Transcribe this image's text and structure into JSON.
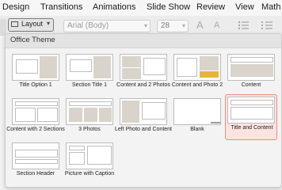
{
  "ribbon": {
    "tabs": [
      "Design",
      "Transitions",
      "Animations",
      "Slide Show",
      "Review",
      "View",
      "Math"
    ],
    "layout_button": {
      "label": "Layout",
      "icon": "layout-icon",
      "chevron": "chevron-down-icon"
    },
    "font_name": "Arial (Body)",
    "font_size": "28"
  },
  "layout_gallery": {
    "theme_title": "Office Theme",
    "selected": "Title and Content",
    "selection_color": "#e79080",
    "layouts": [
      {
        "label": "Title Option 1"
      },
      {
        "label": "Section Title 1"
      },
      {
        "label": "Content and 2 Photos"
      },
      {
        "label": "Content and Photo 2"
      },
      {
        "label": "Content"
      },
      {
        "label": "Content with 2 Sections"
      },
      {
        "label": "3 Photos"
      },
      {
        "label": "Left Photo and Content"
      },
      {
        "label": "Blank"
      },
      {
        "label": "Title and Content"
      },
      {
        "label": "Section Header"
      },
      {
        "label": "Picture with Caption"
      }
    ]
  }
}
